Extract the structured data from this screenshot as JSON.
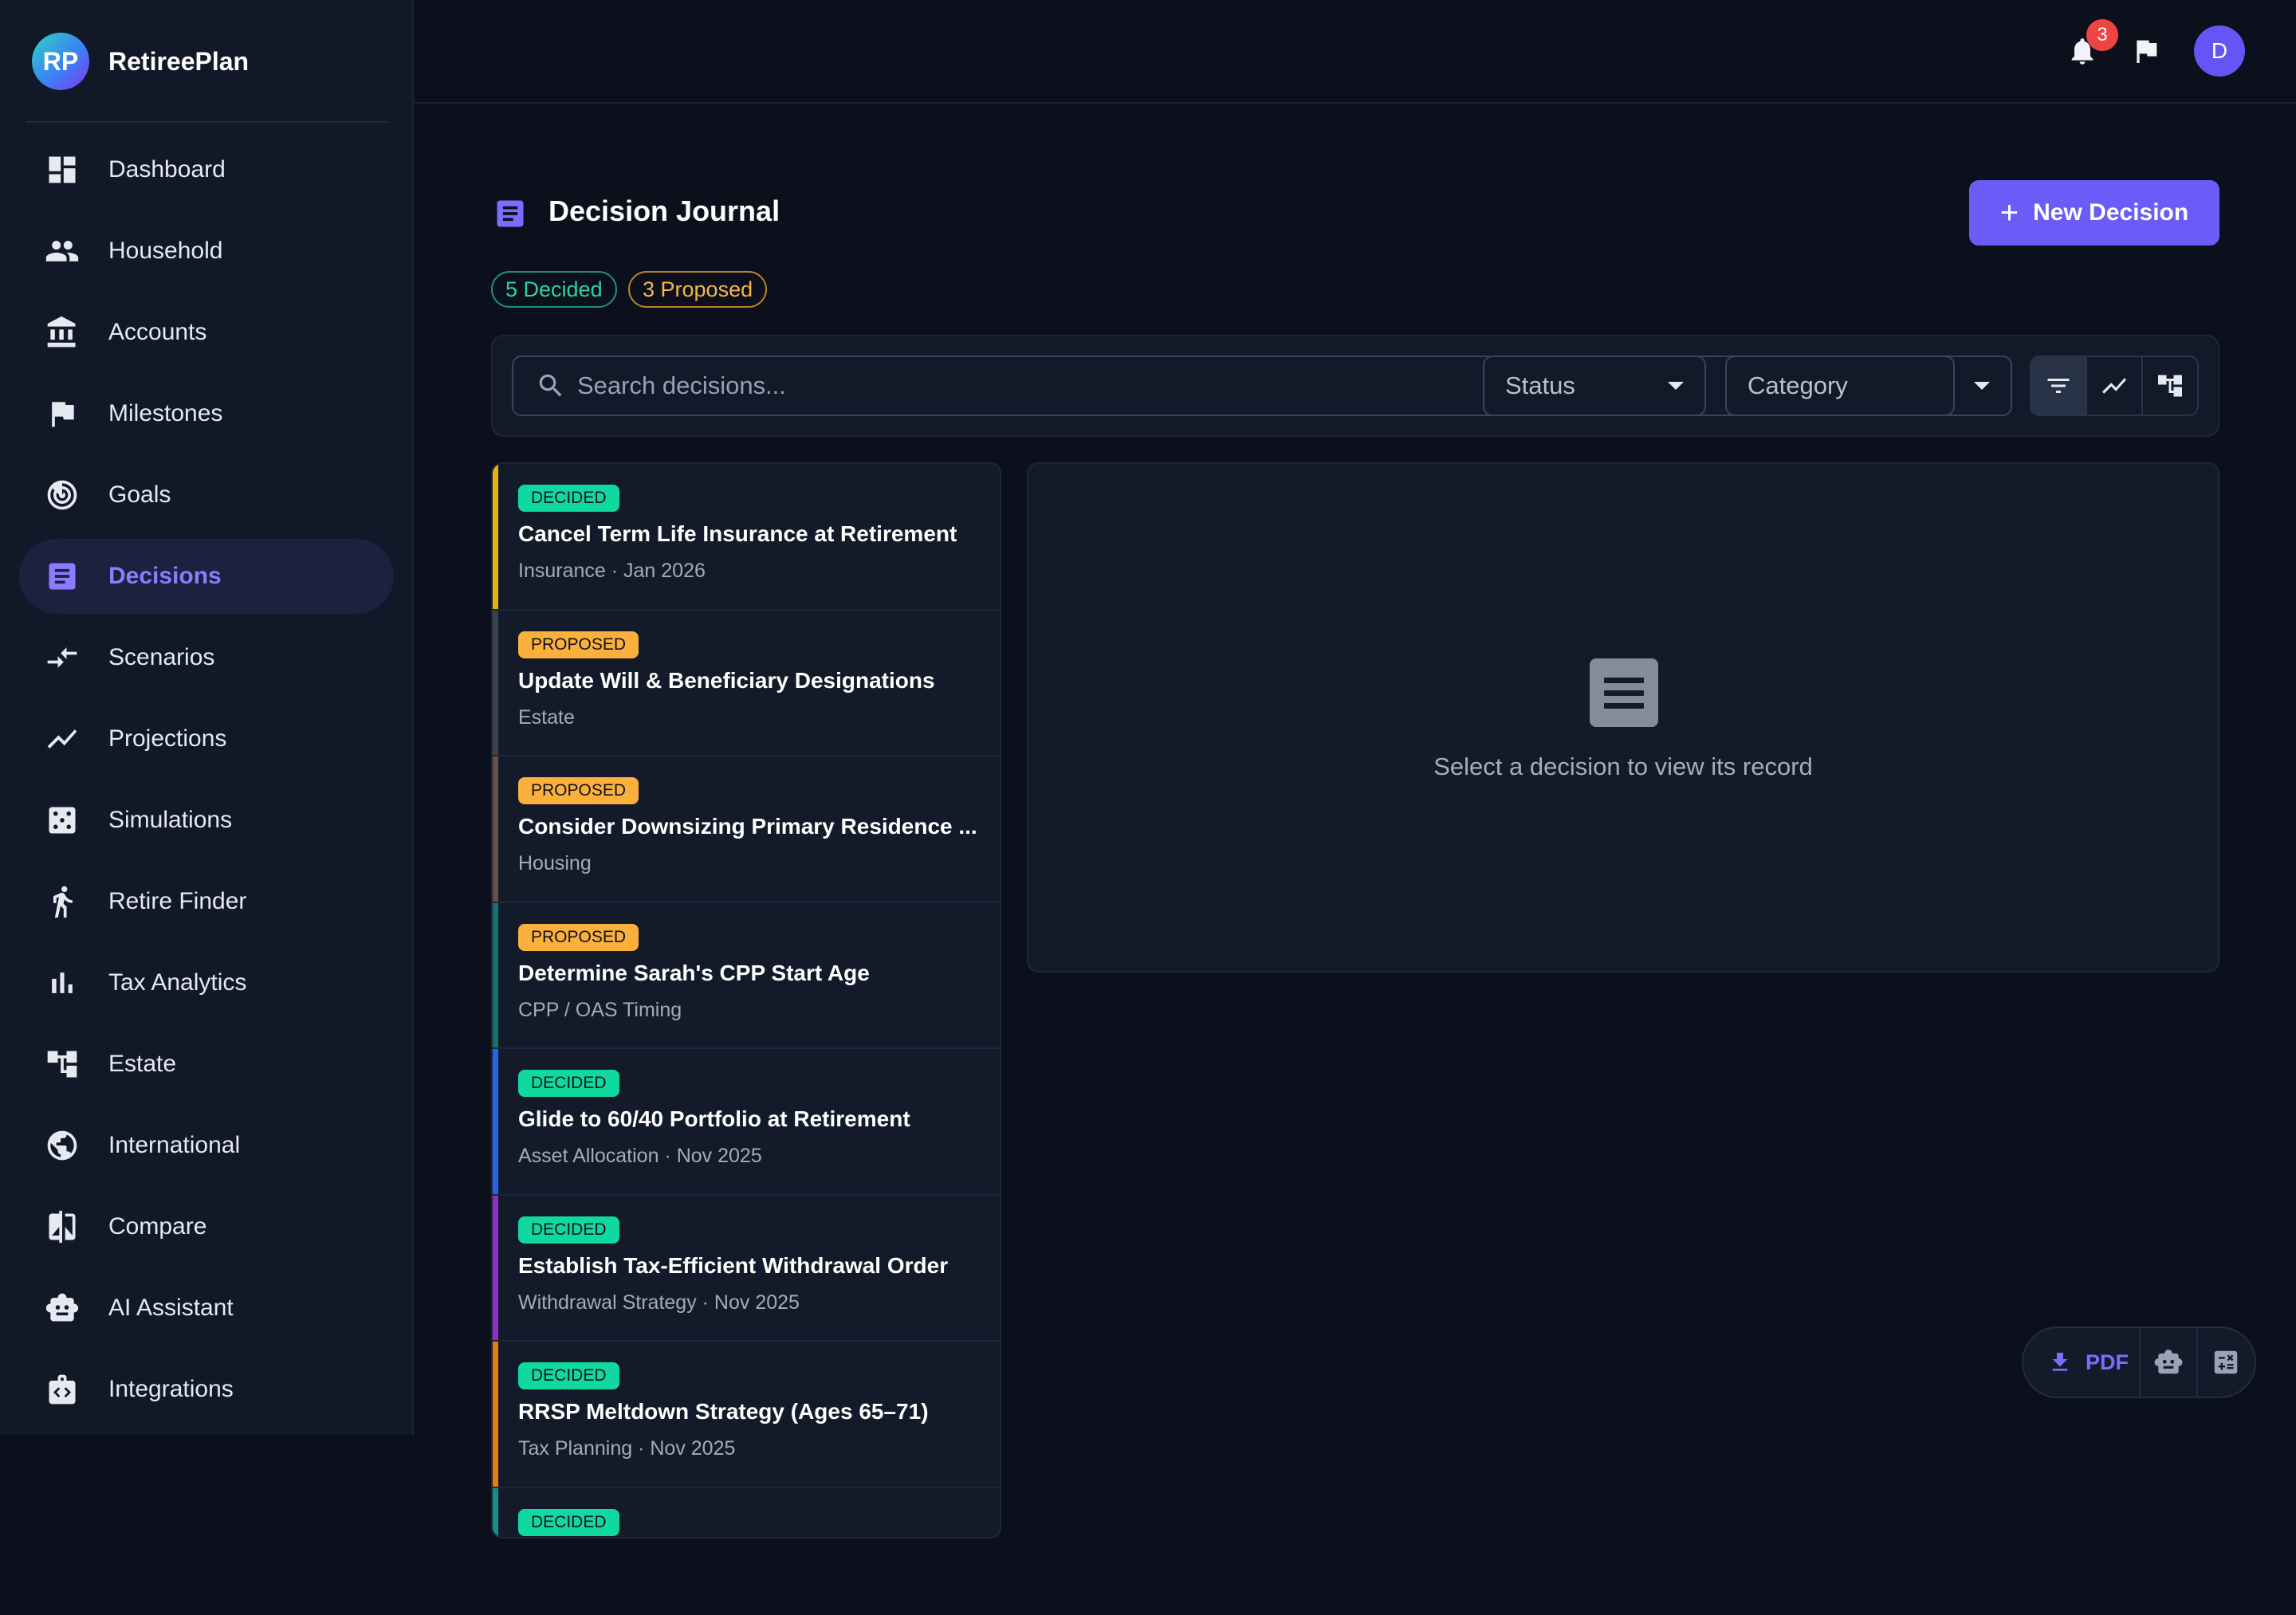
{
  "app": {
    "logo_initials": "RP",
    "name": "RetireePlan"
  },
  "sidebar": {
    "items": [
      {
        "label": "Dashboard",
        "icon": "dashboard-icon"
      },
      {
        "label": "Household",
        "icon": "people-icon"
      },
      {
        "label": "Accounts",
        "icon": "bank-icon"
      },
      {
        "label": "Milestones",
        "icon": "flag-icon"
      },
      {
        "label": "Goals",
        "icon": "target-icon"
      },
      {
        "label": "Decisions",
        "icon": "document-icon",
        "active": true
      },
      {
        "label": "Scenarios",
        "icon": "compare-arrows-icon"
      },
      {
        "label": "Projections",
        "icon": "trend-icon"
      },
      {
        "label": "Simulations",
        "icon": "dice-icon"
      },
      {
        "label": "Retire Finder",
        "icon": "person-walking-icon"
      },
      {
        "label": "Tax Analytics",
        "icon": "bar-chart-icon"
      },
      {
        "label": "Estate",
        "icon": "tree-icon"
      },
      {
        "label": "International",
        "icon": "globe-icon"
      },
      {
        "label": "Compare",
        "icon": "compare-icon"
      },
      {
        "label": "AI Assistant",
        "icon": "robot-icon"
      },
      {
        "label": "Integrations",
        "icon": "integration-icon"
      }
    ]
  },
  "topbar": {
    "notification_count": "3",
    "avatar_initial": "D"
  },
  "page": {
    "title": "Decision Journal",
    "new_button": "New Decision",
    "pill_decided": "5 Decided",
    "pill_proposed": "3 Proposed"
  },
  "filters": {
    "search_placeholder": "Search decisions...",
    "status_label": "Status",
    "category_label": "Category"
  },
  "decisions": [
    {
      "status": "DECIDED",
      "title": "Cancel Term Life Insurance at Retirement",
      "meta": "Insurance · Jan 2026",
      "stripe": "#eab308"
    },
    {
      "status": "PROPOSED",
      "title": "Update Will & Beneficiary Designations",
      "meta": "Estate",
      "stripe": "#3a4250"
    },
    {
      "status": "PROPOSED",
      "title": "Consider Downsizing Primary Residence ...",
      "meta": "Housing",
      "stripe": "#6b4f44"
    },
    {
      "status": "PROPOSED",
      "title": "Determine Sarah's CPP Start Age",
      "meta": "CPP / OAS Timing",
      "stripe": "#0f766e"
    },
    {
      "status": "DECIDED",
      "title": "Glide to 60/40 Portfolio at Retirement",
      "meta": "Asset Allocation · Nov 2025",
      "stripe": "#2563eb"
    },
    {
      "status": "DECIDED",
      "title": "Establish Tax-Efficient Withdrawal Order",
      "meta": "Withdrawal Strategy · Nov 2025",
      "stripe": "#8b2fc9"
    },
    {
      "status": "DECIDED",
      "title": "RRSP Meltdown Strategy (Ages 65–71)",
      "meta": "Tax Planning · Nov 2025",
      "stripe": "#ea7a10"
    },
    {
      "status": "DECIDED",
      "title": "",
      "meta": "",
      "stripe": "#0d9488"
    }
  ],
  "status_colors": {
    "DECIDED": "#10d9a0",
    "PROPOSED": "#fbb03b"
  },
  "detail": {
    "empty_text": "Select a decision to view its record"
  },
  "fab": {
    "pdf_label": "PDF"
  }
}
